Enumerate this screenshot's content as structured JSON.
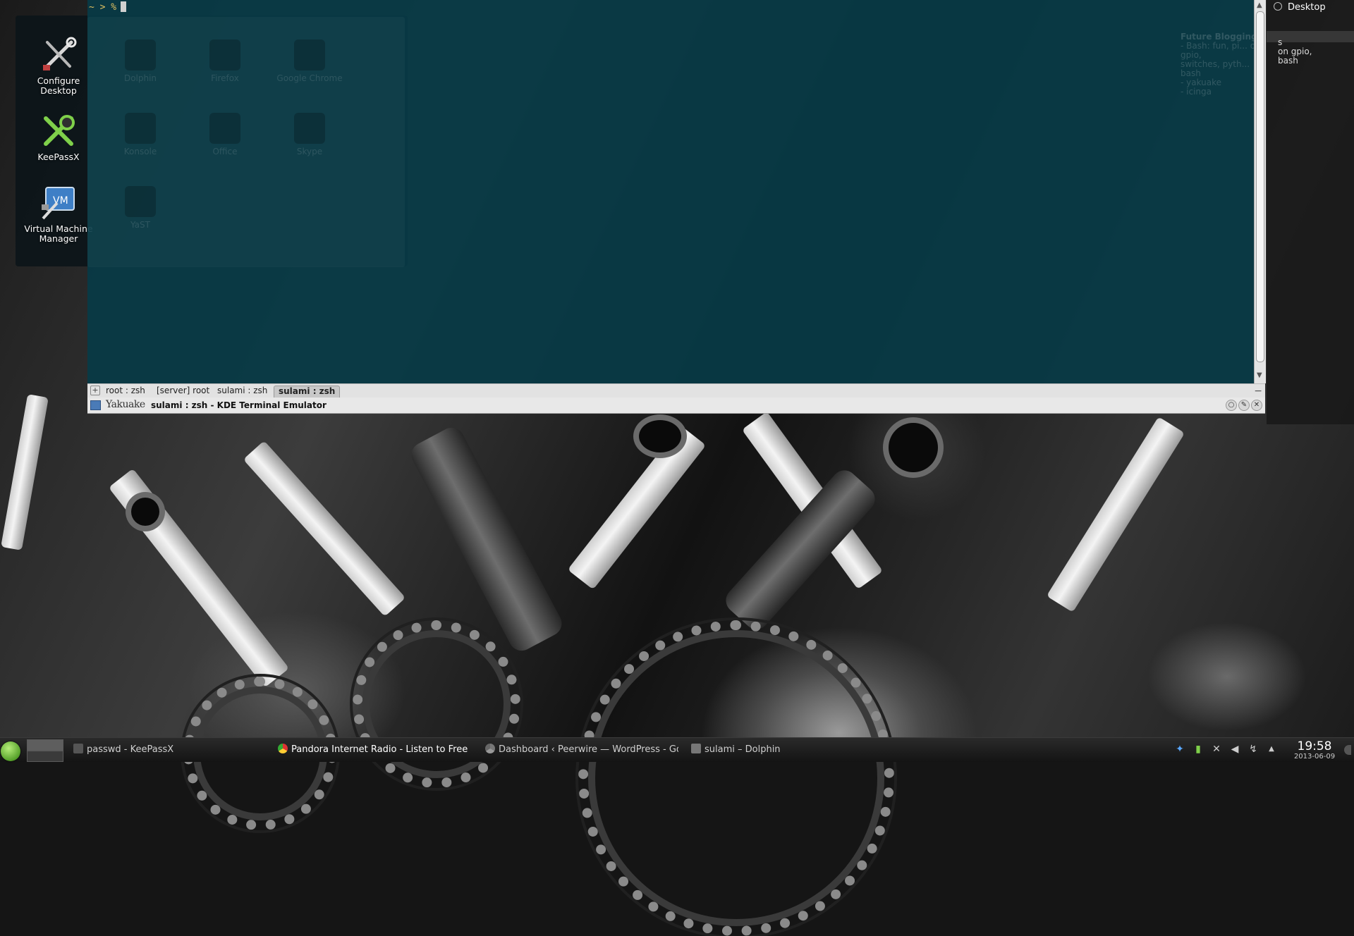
{
  "desktop_icons": [
    {
      "label": "Configure Desktop",
      "icon": "tools-icon"
    },
    {
      "label": "KeePassX",
      "icon": "keepassx-icon"
    },
    {
      "label": "Virtual Machine Manager",
      "icon": "vm-manager-icon"
    }
  ],
  "terminal": {
    "prompt": "~ > %",
    "ghost_icons": [
      "Dolphin",
      "Firefox",
      "Google Chrome",
      "Konsole",
      "Office",
      "Skype",
      "YaST"
    ],
    "ghost_note_title": "Future Bloggings",
    "ghost_note_lines": [
      "- Bash: fun, pi... on gpio,",
      "switches, pyth... bash",
      "- yakuake",
      "- icinga"
    ],
    "tabs": [
      "root : zsh",
      "[server] root",
      "sulami : zsh",
      "sulami : zsh"
    ],
    "active_tab": 3,
    "brand": "Yakuake",
    "window_title": "sulami : zsh - KDE Terminal Emulator"
  },
  "activity": {
    "label": "Desktop"
  },
  "notes_widget": {
    "lines": [
      "s",
      "on gpio,",
      "bash"
    ]
  },
  "taskbar": {
    "tasks": [
      {
        "label": "passwd - KeePassX",
        "icon": "keepassx-icon"
      },
      {
        "label": "Pandora Internet Radio - Listen to Free Mu",
        "icon": "chrome-icon"
      },
      {
        "label": "Dashboard ‹ Peerwire — WordPress - Goo",
        "icon": "chrome-icon"
      },
      {
        "label": "sulami – Dolphin",
        "icon": "dolphin-icon"
      }
    ],
    "clock_time": "19:58",
    "clock_date": "2013-06-09"
  },
  "colors": {
    "terminal_bg": "#083a46",
    "prompt": "#e0c060",
    "panel": "#1e1e1e",
    "kicker": "#56a02a"
  }
}
